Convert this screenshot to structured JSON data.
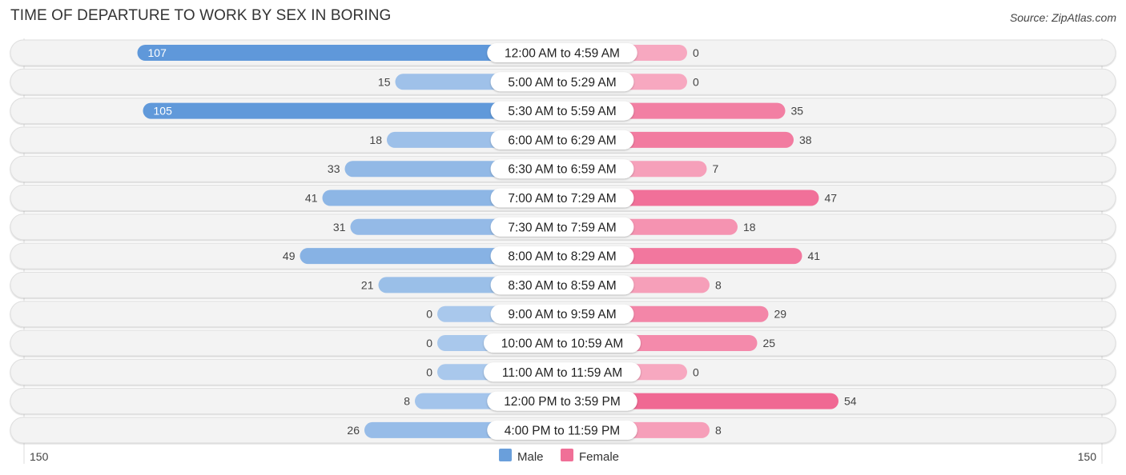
{
  "header": {
    "title": "TIME OF DEPARTURE TO WORK BY SEX IN BORING",
    "source": "Source: ZipAtlas.com"
  },
  "chart_data": {
    "type": "bar",
    "orientation": "horizontal-diverging",
    "title": "TIME OF DEPARTURE TO WORK BY SEX IN BORING",
    "categories": [
      "12:00 AM to 4:59 AM",
      "5:00 AM to 5:29 AM",
      "5:30 AM to 5:59 AM",
      "6:00 AM to 6:29 AM",
      "6:30 AM to 6:59 AM",
      "7:00 AM to 7:29 AM",
      "7:30 AM to 7:59 AM",
      "8:00 AM to 8:29 AM",
      "8:30 AM to 8:59 AM",
      "9:00 AM to 9:59 AM",
      "10:00 AM to 10:59 AM",
      "11:00 AM to 11:59 AM",
      "12:00 PM to 3:59 PM",
      "4:00 PM to 11:59 PM"
    ],
    "series": [
      {
        "name": "Male",
        "color": "#6a9fdb",
        "values": [
          107,
          15,
          105,
          18,
          33,
          41,
          31,
          49,
          21,
          0,
          0,
          0,
          8,
          26
        ]
      },
      {
        "name": "Female",
        "color": "#f06f97",
        "values": [
          0,
          0,
          35,
          38,
          7,
          47,
          18,
          41,
          8,
          29,
          25,
          0,
          54,
          8
        ]
      }
    ],
    "axis": {
      "left_label": "150",
      "right_label": "150",
      "range": [
        0,
        150
      ]
    },
    "legend": {
      "position": "bottom-center",
      "items": [
        "Male",
        "Female"
      ]
    },
    "grid": false
  }
}
